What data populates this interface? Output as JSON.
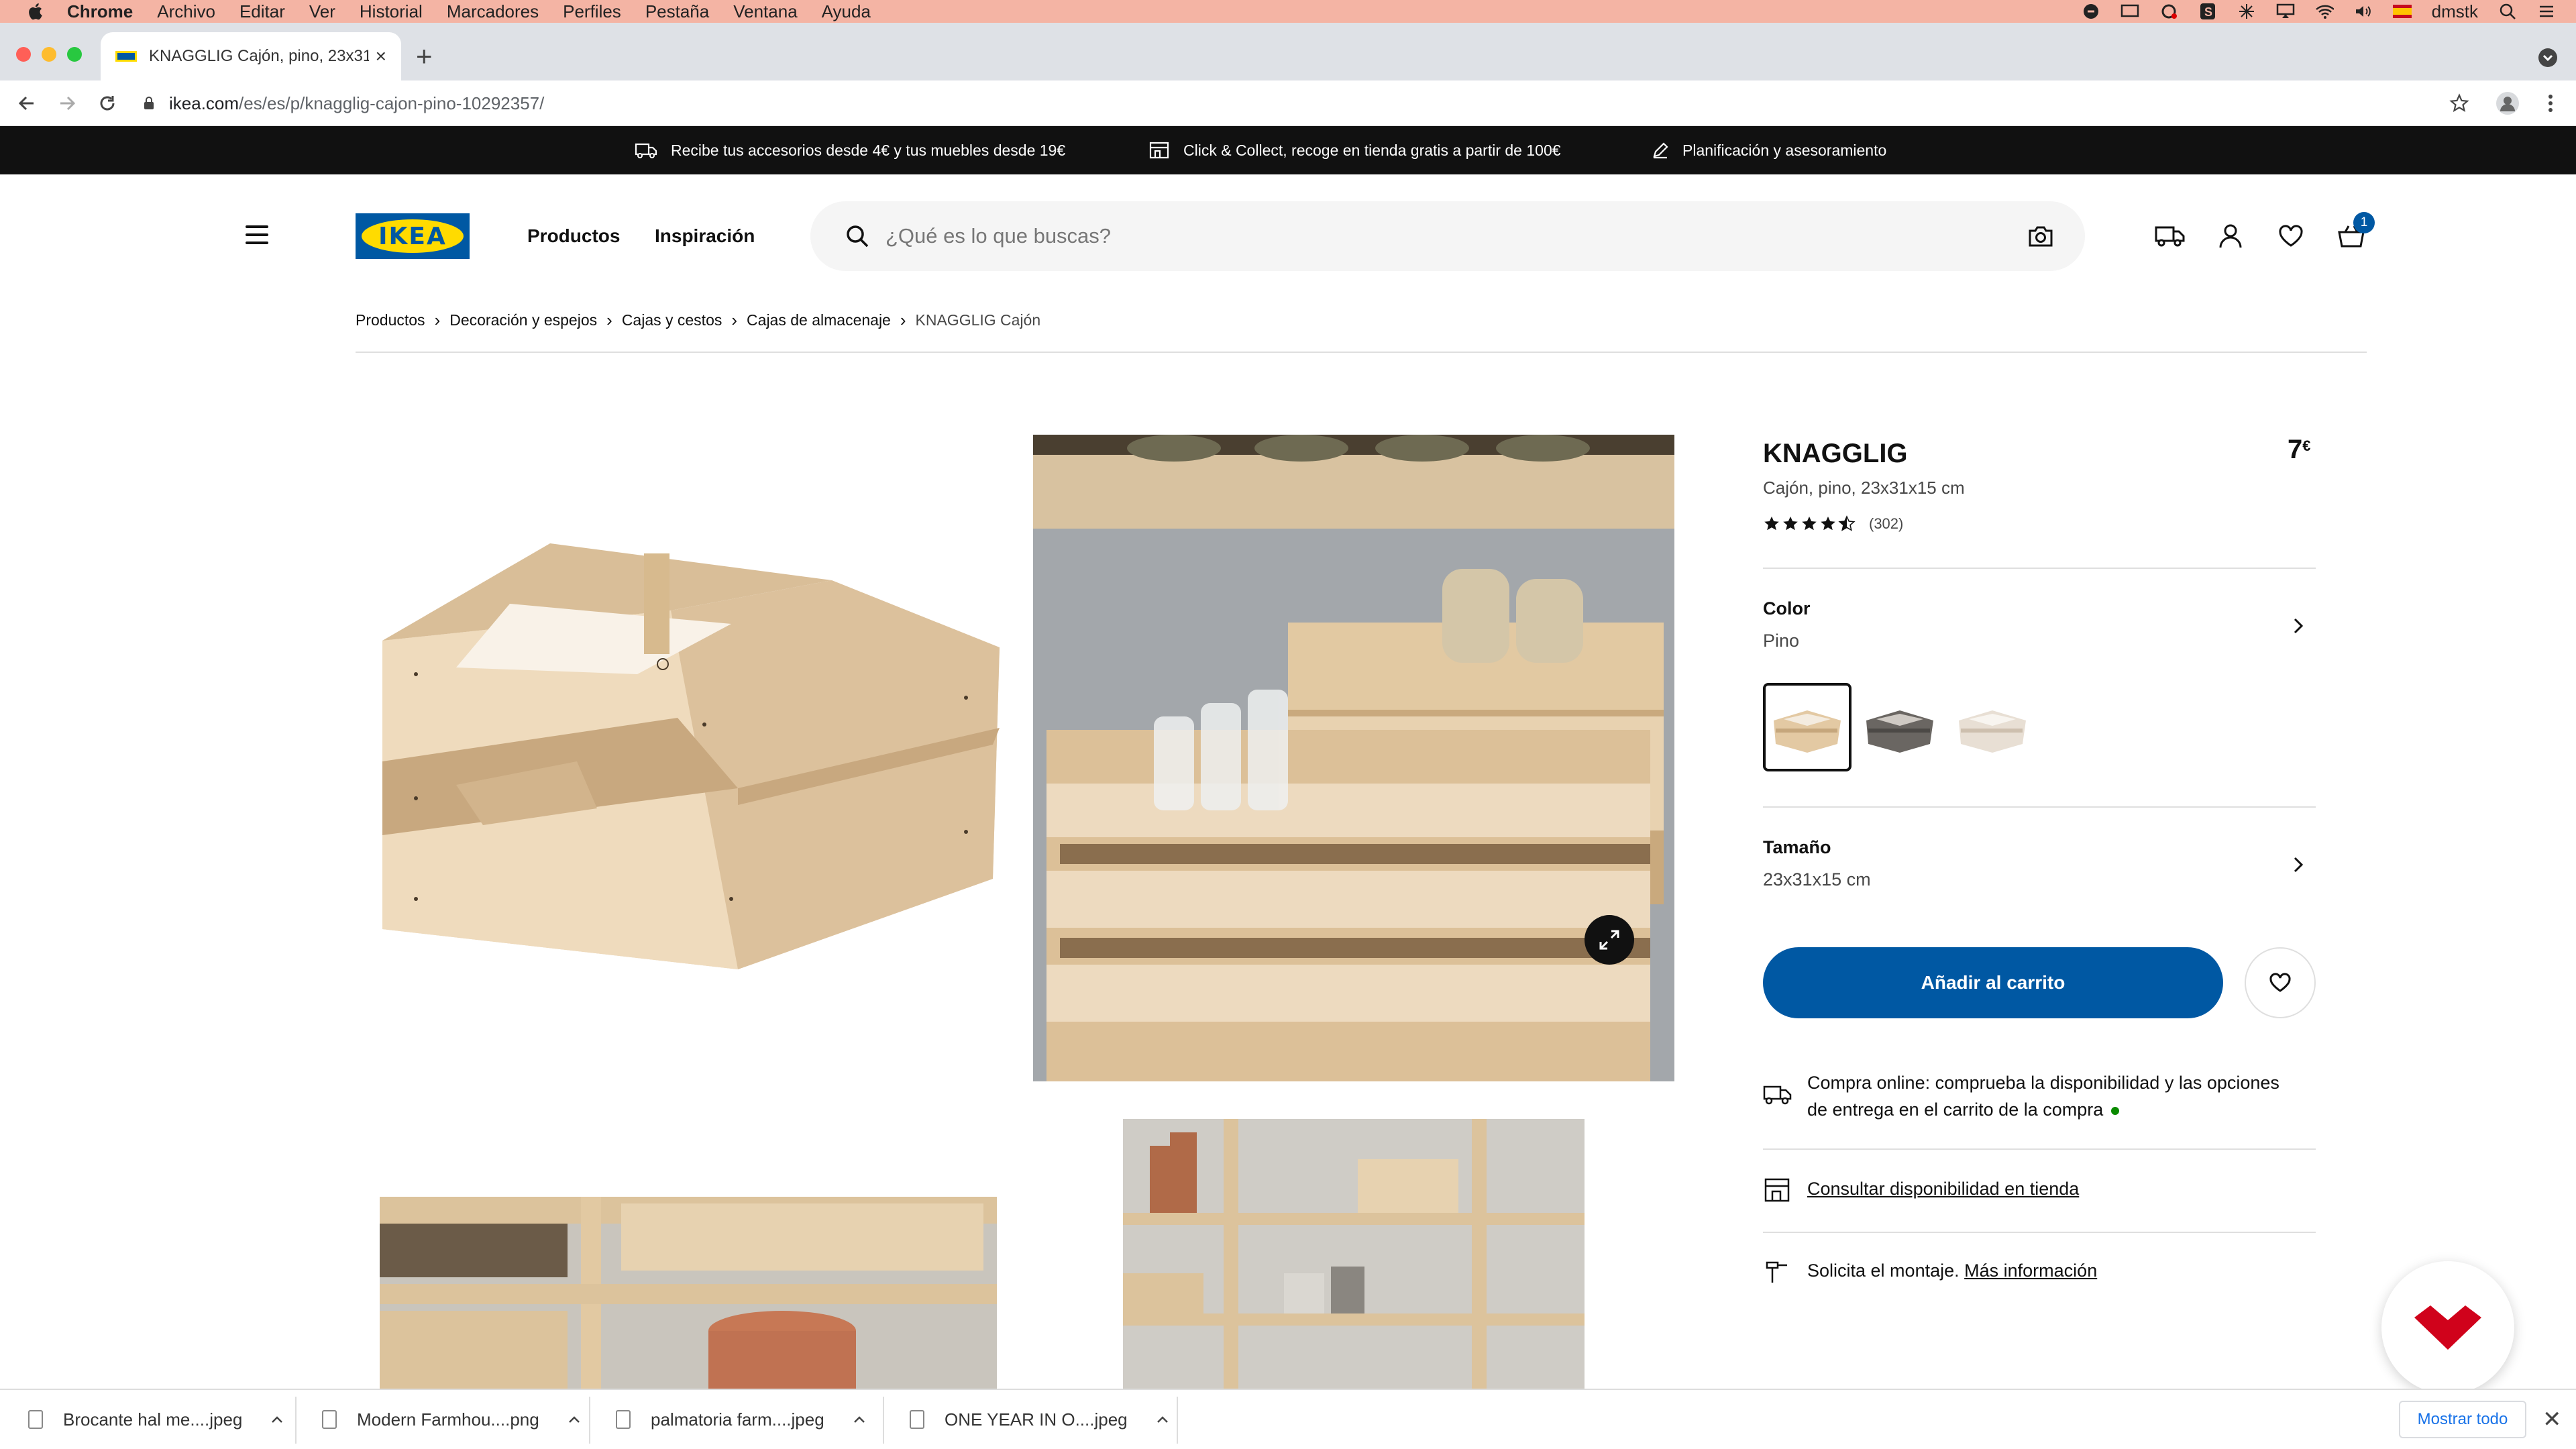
{
  "menubar": {
    "app": "Chrome",
    "items": [
      "Archivo",
      "Editar",
      "Ver",
      "Historial",
      "Marcadores",
      "Perfiles",
      "Pestaña",
      "Ventana",
      "Ayuda"
    ],
    "user": "dmstk"
  },
  "browser": {
    "tab_title": "KNAGGLIG Cajón, pino, 23x31x",
    "url_host": "ikea.com",
    "url_path": "/es/es/p/knagglig-cajon-pino-10292357/"
  },
  "promo": {
    "items": [
      "Recibe tus accesorios desde 4€ y tus muebles desde 19€",
      "Click & Collect, recoge en tienda gratis a partir de 100€",
      "Planificación y asesoramiento"
    ]
  },
  "header": {
    "logo_text": "IKEA",
    "nav": [
      "Productos",
      "Inspiración"
    ],
    "search_placeholder": "¿Qué es lo que buscas?",
    "cart_count": "1"
  },
  "breadcrumb": [
    "Productos",
    "Decoración y espejos",
    "Cajas y cestos",
    "Cajas de almacenaje",
    "KNAGGLIG Cajón"
  ],
  "product": {
    "name": "KNAGGLIG",
    "price": "7",
    "currency": "€",
    "description": "Cajón, pino, 23x31x15 cm",
    "rating": 4.5,
    "review_count": "(302)",
    "color_label": "Color",
    "color_value": "Pino",
    "size_label": "Tamaño",
    "size_value": "23x31x15 cm",
    "add_to_cart": "Añadir al carrito",
    "online_text_1": "Compra online: comprueba la disponibilidad y las opciones",
    "online_text_2": "de entrega en el carrito de la compra",
    "store_link": "Consultar disponibilidad en tienda",
    "assembly_text": "Solicita el montaje.",
    "assembly_link": "Más información"
  },
  "colors": {
    "ikea_blue": "#0058a3",
    "ikea_yellow": "#ffdb00",
    "menubar_bg": "#f4b4a4"
  },
  "downloads": {
    "files": [
      "Brocante hal me....jpeg",
      "Modern Farmhou....png",
      "palmatoria farm....jpeg",
      "ONE YEAR IN O....jpeg"
    ],
    "show_all": "Mostrar todo"
  }
}
